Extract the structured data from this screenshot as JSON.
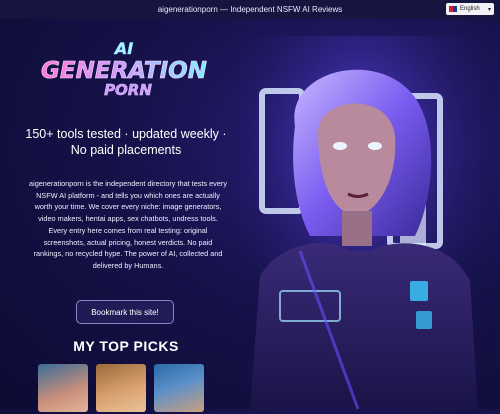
{
  "topbar": {
    "title": "aigenerationporn — Independent NSFW AI Reviews"
  },
  "language": {
    "selected": "English",
    "flag_icon": "uk-flag-icon"
  },
  "logo": {
    "line1": "AI",
    "line2": "GENERATION",
    "line3": "PORN"
  },
  "headline": "150+ tools tested · updated weekly · No paid placements",
  "description": "aigenerationporn is the independent directory that tests every NSFW AI platform - and tells you which ones are actually worth your time. We cover every niche: image generators, video makers, hentai apps, sex chatbots, undress tools. Every entry here comes from real testing: original screenshots, actual pricing, honest verdicts. No paid rankings, no recycled hype. The power of AI, collected and delivered by Humans.",
  "bookmark_button": "Bookmark this site!",
  "picks": {
    "title": "MY TOP PICKS"
  },
  "colors": {
    "background": "#16124a",
    "topbar": "#16153f",
    "accent": "#8b84c9"
  }
}
